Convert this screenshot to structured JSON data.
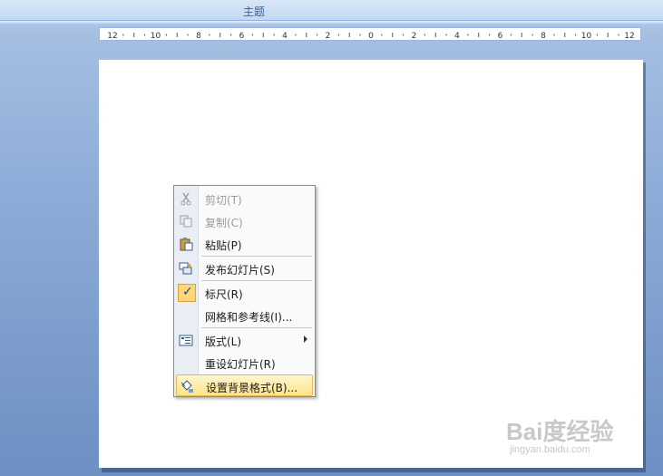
{
  "ribbon": {
    "group_label": "主题"
  },
  "ruler": {
    "labels": [
      "12",
      "10",
      "8",
      "6",
      "4",
      "2",
      "0",
      "2",
      "4",
      "6",
      "8",
      "10",
      "12"
    ]
  },
  "menu": {
    "items": [
      {
        "label": "剪切(T)",
        "icon": "scissors-icon",
        "enabled": false
      },
      {
        "label": "复制(C)",
        "icon": "copy-icon",
        "enabled": false
      },
      {
        "label": "粘贴(P)",
        "icon": "paste-icon",
        "enabled": true
      },
      {
        "label": "发布幻灯片(S)",
        "icon": "publish-slides-icon",
        "enabled": true
      },
      {
        "label": "标尺(R)",
        "icon": "checkmark-icon",
        "enabled": true,
        "checked": true
      },
      {
        "label": "网格和参考线(I)...",
        "icon": "",
        "enabled": true
      },
      {
        "label": "版式(L)",
        "icon": "layout-icon",
        "enabled": true,
        "submenu": true
      },
      {
        "label": "重设幻灯片(R)",
        "icon": "",
        "enabled": true
      },
      {
        "label": "设置背景格式(B)...",
        "icon": "paint-bucket-icon",
        "enabled": true,
        "highlighted": true
      }
    ]
  },
  "watermark": {
    "logo": "Bai度经验",
    "url": "jingyan.baidu.com"
  },
  "colors": {
    "highlight": "#ffe487",
    "ribbon_text": "#3f5f95"
  }
}
